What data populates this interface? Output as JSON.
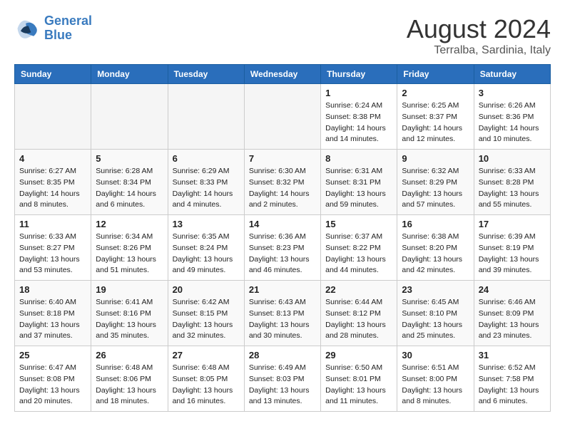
{
  "header": {
    "logo_line1": "General",
    "logo_line2": "Blue",
    "month_title": "August 2024",
    "location": "Terralba, Sardinia, Italy"
  },
  "days_of_week": [
    "Sunday",
    "Monday",
    "Tuesday",
    "Wednesday",
    "Thursday",
    "Friday",
    "Saturday"
  ],
  "weeks": [
    [
      {
        "day": "",
        "empty": true
      },
      {
        "day": "",
        "empty": true
      },
      {
        "day": "",
        "empty": true
      },
      {
        "day": "",
        "empty": true
      },
      {
        "day": "1",
        "sunrise": "6:24 AM",
        "sunset": "8:38 PM",
        "daylight": "14 hours and 14 minutes."
      },
      {
        "day": "2",
        "sunrise": "6:25 AM",
        "sunset": "8:37 PM",
        "daylight": "14 hours and 12 minutes."
      },
      {
        "day": "3",
        "sunrise": "6:26 AM",
        "sunset": "8:36 PM",
        "daylight": "14 hours and 10 minutes."
      }
    ],
    [
      {
        "day": "4",
        "sunrise": "6:27 AM",
        "sunset": "8:35 PM",
        "daylight": "14 hours and 8 minutes."
      },
      {
        "day": "5",
        "sunrise": "6:28 AM",
        "sunset": "8:34 PM",
        "daylight": "14 hours and 6 minutes."
      },
      {
        "day": "6",
        "sunrise": "6:29 AM",
        "sunset": "8:33 PM",
        "daylight": "14 hours and 4 minutes."
      },
      {
        "day": "7",
        "sunrise": "6:30 AM",
        "sunset": "8:32 PM",
        "daylight": "14 hours and 2 minutes."
      },
      {
        "day": "8",
        "sunrise": "6:31 AM",
        "sunset": "8:31 PM",
        "daylight": "13 hours and 59 minutes."
      },
      {
        "day": "9",
        "sunrise": "6:32 AM",
        "sunset": "8:29 PM",
        "daylight": "13 hours and 57 minutes."
      },
      {
        "day": "10",
        "sunrise": "6:33 AM",
        "sunset": "8:28 PM",
        "daylight": "13 hours and 55 minutes."
      }
    ],
    [
      {
        "day": "11",
        "sunrise": "6:33 AM",
        "sunset": "8:27 PM",
        "daylight": "13 hours and 53 minutes."
      },
      {
        "day": "12",
        "sunrise": "6:34 AM",
        "sunset": "8:26 PM",
        "daylight": "13 hours and 51 minutes."
      },
      {
        "day": "13",
        "sunrise": "6:35 AM",
        "sunset": "8:24 PM",
        "daylight": "13 hours and 49 minutes."
      },
      {
        "day": "14",
        "sunrise": "6:36 AM",
        "sunset": "8:23 PM",
        "daylight": "13 hours and 46 minutes."
      },
      {
        "day": "15",
        "sunrise": "6:37 AM",
        "sunset": "8:22 PM",
        "daylight": "13 hours and 44 minutes."
      },
      {
        "day": "16",
        "sunrise": "6:38 AM",
        "sunset": "8:20 PM",
        "daylight": "13 hours and 42 minutes."
      },
      {
        "day": "17",
        "sunrise": "6:39 AM",
        "sunset": "8:19 PM",
        "daylight": "13 hours and 39 minutes."
      }
    ],
    [
      {
        "day": "18",
        "sunrise": "6:40 AM",
        "sunset": "8:18 PM",
        "daylight": "13 hours and 37 minutes."
      },
      {
        "day": "19",
        "sunrise": "6:41 AM",
        "sunset": "8:16 PM",
        "daylight": "13 hours and 35 minutes."
      },
      {
        "day": "20",
        "sunrise": "6:42 AM",
        "sunset": "8:15 PM",
        "daylight": "13 hours and 32 minutes."
      },
      {
        "day": "21",
        "sunrise": "6:43 AM",
        "sunset": "8:13 PM",
        "daylight": "13 hours and 30 minutes."
      },
      {
        "day": "22",
        "sunrise": "6:44 AM",
        "sunset": "8:12 PM",
        "daylight": "13 hours and 28 minutes."
      },
      {
        "day": "23",
        "sunrise": "6:45 AM",
        "sunset": "8:10 PM",
        "daylight": "13 hours and 25 minutes."
      },
      {
        "day": "24",
        "sunrise": "6:46 AM",
        "sunset": "8:09 PM",
        "daylight": "13 hours and 23 minutes."
      }
    ],
    [
      {
        "day": "25",
        "sunrise": "6:47 AM",
        "sunset": "8:08 PM",
        "daylight": "13 hours and 20 minutes."
      },
      {
        "day": "26",
        "sunrise": "6:48 AM",
        "sunset": "8:06 PM",
        "daylight": "13 hours and 18 minutes."
      },
      {
        "day": "27",
        "sunrise": "6:48 AM",
        "sunset": "8:05 PM",
        "daylight": "13 hours and 16 minutes."
      },
      {
        "day": "28",
        "sunrise": "6:49 AM",
        "sunset": "8:03 PM",
        "daylight": "13 hours and 13 minutes."
      },
      {
        "day": "29",
        "sunrise": "6:50 AM",
        "sunset": "8:01 PM",
        "daylight": "13 hours and 11 minutes."
      },
      {
        "day": "30",
        "sunrise": "6:51 AM",
        "sunset": "8:00 PM",
        "daylight": "13 hours and 8 minutes."
      },
      {
        "day": "31",
        "sunrise": "6:52 AM",
        "sunset": "7:58 PM",
        "daylight": "13 hours and 6 minutes."
      }
    ]
  ]
}
